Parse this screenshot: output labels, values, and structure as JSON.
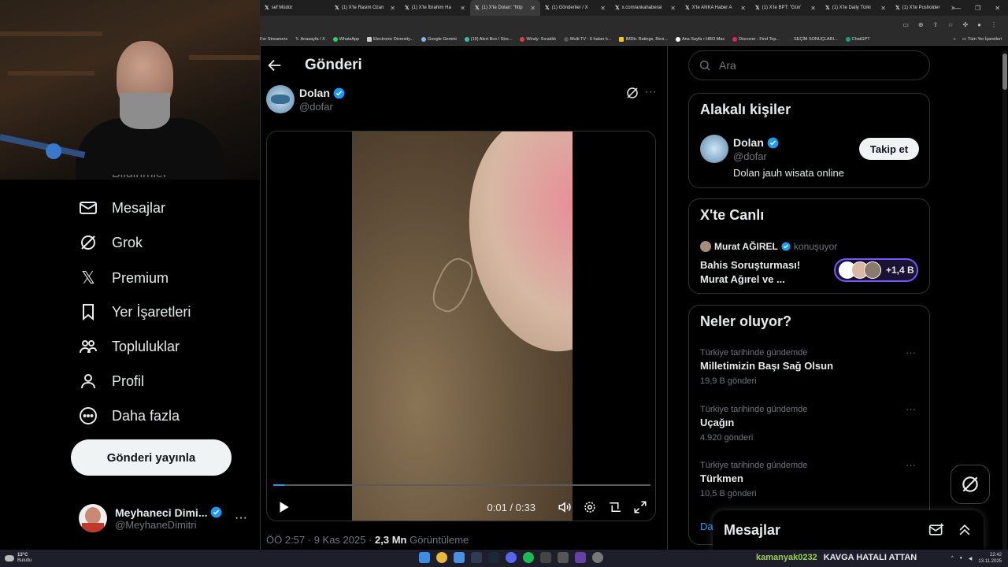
{
  "browser": {
    "tabs": [
      {
        "label": "sef Müdür"
      },
      {
        "label": "(1) X'te Rasim Ozan"
      },
      {
        "label": "(1) X'te İbrahim Ha"
      },
      {
        "label": "(1) X'te Dolan: \"http",
        "active": true
      },
      {
        "label": "(1) Gönderiler / X"
      },
      {
        "label": "x.com/ankahaberal"
      },
      {
        "label": "X'te ANKA Haber A"
      },
      {
        "label": "(1) X'te BPT: \"Gün'"
      },
      {
        "label": "(1) X'te Daily Türki"
      },
      {
        "label": "(1) X'te Pusholder"
      }
    ],
    "bookmarks": [
      "For Streamers",
      "Anasayfa / X",
      "WhatsApp",
      "Electronic Diversity...",
      "Google Gemini",
      "(19) Alert Box / Stre...",
      "Windy: Sıcaklık",
      "Multi TV - 6 haber k...",
      "IMDb: Ratings, Revi...",
      "Ana Sayfa • HBO Max",
      "Discover - Find Top...",
      "SEÇİM SONUÇLARI...",
      "ChatGPT"
    ],
    "bookmarks_all": "Tüm Yer İşaretleri"
  },
  "nav": {
    "items": [
      {
        "label": "Bildirimler"
      },
      {
        "label": "Mesajlar"
      },
      {
        "label": "Grok"
      },
      {
        "label": "Premium"
      },
      {
        "label": "Yer İşaretleri"
      },
      {
        "label": "Topluluklar"
      },
      {
        "label": "Profil"
      },
      {
        "label": "Daha fazla"
      }
    ],
    "post_button": "Gönderi yayınla",
    "account": {
      "name": "Meyhaneci Dimi...",
      "handle": "@MeyhaneDimitri"
    }
  },
  "post": {
    "header_title": "Gönderi",
    "author_name": "Dolan",
    "author_handle": "@dofar",
    "video": {
      "time": "0:01 / 0:33",
      "progress": 0.03
    },
    "meta_time": "ÖÖ 2:57 · 9 Kas 2025 · ",
    "meta_views": "2,3 Mn",
    "meta_views_label": " Görüntüleme"
  },
  "right": {
    "search_placeholder": "Ara",
    "related": {
      "title": "Alakalı kişiler",
      "name": "Dolan",
      "handle": "@dofar",
      "bio": "Dolan jauh wisata online",
      "follow_label": "Takip et"
    },
    "live": {
      "title": "X'te Canlı",
      "host": "Murat AĞIREL",
      "status": "konuşuyor",
      "topic": "Bahis Soruşturması! Murat Ağırel ve ...",
      "listeners": "+1,4 B"
    },
    "trends": {
      "title": "Neler oluyor?",
      "items": [
        {
          "category": "Türkiye tarihinde gündemde",
          "name": "Milletimizin Başı Sağ Olsun",
          "count": "19,9 B gönderi"
        },
        {
          "category": "Türkiye tarihinde gündemde",
          "name": "Uçağın",
          "count": "4.920 gönderi"
        },
        {
          "category": "Türkiye tarihinde gündemde",
          "name": "Türkmen",
          "count": "10,5 B gönderi"
        }
      ],
      "more_partial": "Da"
    },
    "messages_label": "Mesajlar"
  },
  "taskbar": {
    "weather_temp": "13°C",
    "weather_desc": "Bulutlu",
    "ticker_user": "kamanyak0232",
    "ticker_msg": "KAVGA HATALI ATTAN",
    "time": "22:42",
    "date": "13.11.2025"
  },
  "colors": {
    "accent": "#1d9bf0",
    "verified": "#1d9bf0",
    "live_border": "#7856ff"
  }
}
